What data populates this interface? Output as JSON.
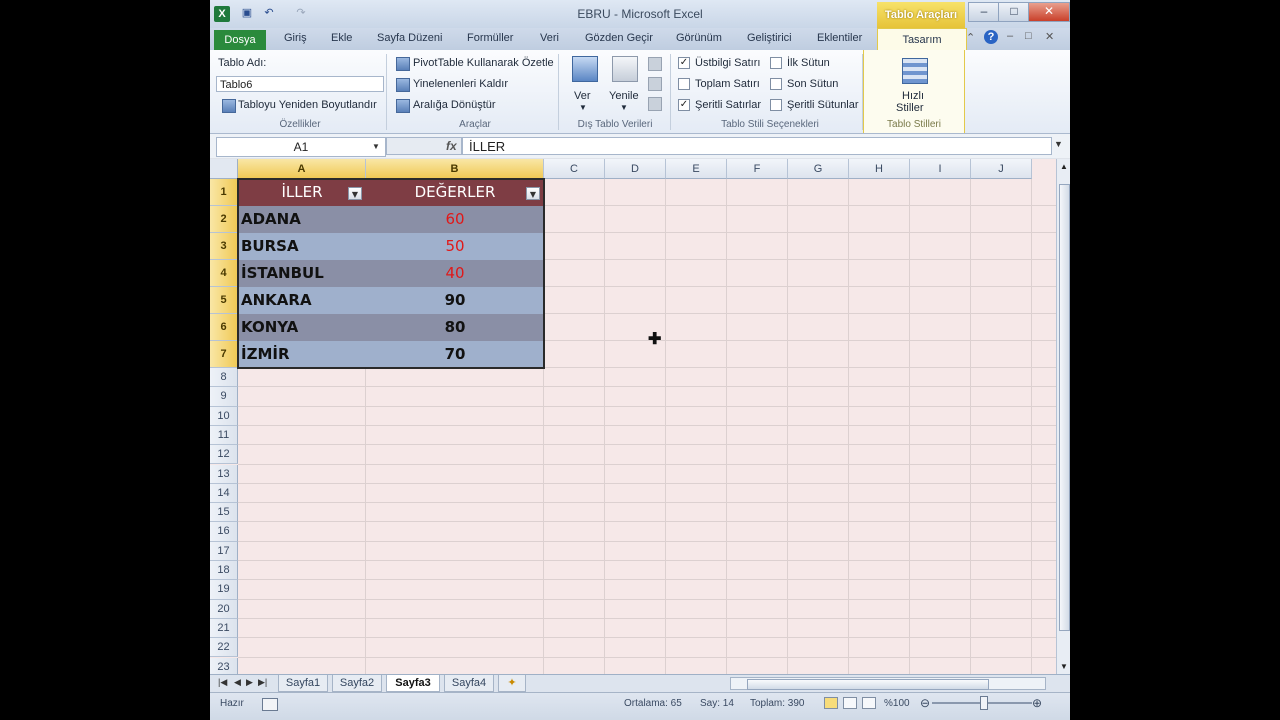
{
  "window": {
    "title": "EBRU - Microsoft Excel",
    "context_header": "Tablo Araçları"
  },
  "tabs": [
    "Dosya",
    "Giriş",
    "Ekle",
    "Sayfa Düzeni",
    "Formüller",
    "Veri",
    "Gözden Geçir",
    "Görünüm",
    "Geliştirici",
    "Eklentiler",
    "Tasarım"
  ],
  "ribbon": {
    "properties": {
      "table_name_label": "Tablo Adı:",
      "table_name_value": "Tablo6",
      "resize_label": "Tabloyu Yeniden Boyutlandır",
      "group_label": "Özellikler"
    },
    "tools": {
      "pivot_label": "PivotTable Kullanarak Özetle",
      "remove_dup_label": "Yinelenenleri Kaldır",
      "convert_label": "Aralığa Dönüştür",
      "group_label": "Araçlar"
    },
    "external": {
      "export_label": "Ver",
      "refresh_label": "Yenile",
      "group_label": "Dış Tablo Verileri"
    },
    "style_options": {
      "header_row": {
        "label": "Üstbilgi Satırı",
        "checked": true
      },
      "total_row": {
        "label": "Toplam Satırı",
        "checked": false
      },
      "banded_rows": {
        "label": "Şeritli Satırlar",
        "checked": true
      },
      "first_column": {
        "label": "İlk Sütun",
        "checked": false
      },
      "last_column": {
        "label": "Son Sütun",
        "checked": false
      },
      "banded_columns": {
        "label": "Şeritli Sütunlar",
        "checked": false
      },
      "group_label": "Tablo Stili Seçenekleri"
    },
    "styles": {
      "quick_styles_line1": "Hızlı",
      "quick_styles_line2": "Stiller",
      "group_label": "Tablo Stilleri"
    }
  },
  "formula_bar": {
    "name_box": "A1",
    "formula": "İLLER"
  },
  "grid": {
    "columns": [
      "A",
      "B",
      "C",
      "D",
      "E",
      "F",
      "G",
      "H",
      "I",
      "J"
    ],
    "rows": [
      "1",
      "2",
      "3",
      "4",
      "5",
      "6",
      "7",
      "8",
      "9",
      "10",
      "11",
      "12",
      "13",
      "14",
      "15",
      "16",
      "17",
      "18",
      "19",
      "20",
      "21",
      "22",
      "23"
    ],
    "table": {
      "headers": [
        "İLLER",
        "DEĞERLER"
      ],
      "rows": [
        {
          "city": "ADANA",
          "value": "60",
          "highlight": true
        },
        {
          "city": "BURSA",
          "value": "50",
          "highlight": true
        },
        {
          "city": "İSTANBUL",
          "value": "40",
          "highlight": true
        },
        {
          "city": "ANKARA",
          "value": "90",
          "highlight": false
        },
        {
          "city": "KONYA",
          "value": "80",
          "highlight": false
        },
        {
          "city": "İZMİR",
          "value": "70",
          "highlight": false
        }
      ]
    },
    "colors": {
      "header_bg": "#7e3d44",
      "band_dark": "#8a8fa6",
      "band_light": "#9fb0cc",
      "highlight_text": "#e01818",
      "normal_text": "#111111"
    }
  },
  "sheets": {
    "tabs": [
      "Sayfa1",
      "Sayfa2",
      "Sayfa3",
      "Sayfa4"
    ],
    "active": "Sayfa3"
  },
  "status": {
    "ready": "Hazır",
    "average": "Ortalama: 65",
    "count": "Say: 14",
    "sum": "Toplam: 390",
    "zoom": "%100"
  }
}
